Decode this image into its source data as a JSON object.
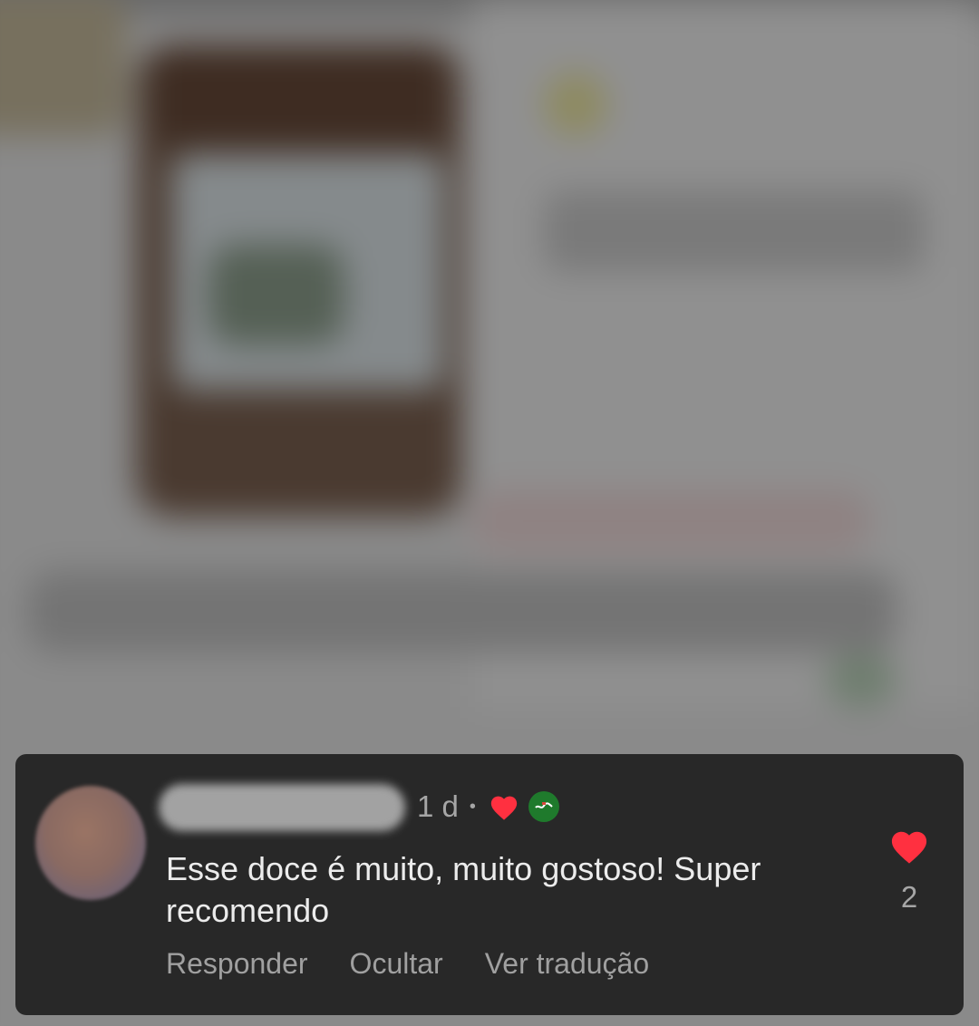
{
  "post": {
    "background_description_icon": "blurred-post-photo"
  },
  "comment": {
    "timestamp": "1 d",
    "separator": "•",
    "creator_liked_icon": "heart-icon",
    "creator_badge_icon": "profile-badge-icon",
    "text": "Esse doce é muito, muito gostoso! Super recomendo",
    "actions": {
      "reply": "Responder",
      "hide": "Ocultar",
      "translate": "Ver tradução"
    },
    "likes": {
      "icon": "heart-icon",
      "count": "2"
    }
  },
  "colors": {
    "card_background": "#282828",
    "heart_red": "#ff3040",
    "text_primary": "#ececec",
    "text_secondary": "#a6a6a6",
    "badge_green": "#1f7a2c"
  }
}
